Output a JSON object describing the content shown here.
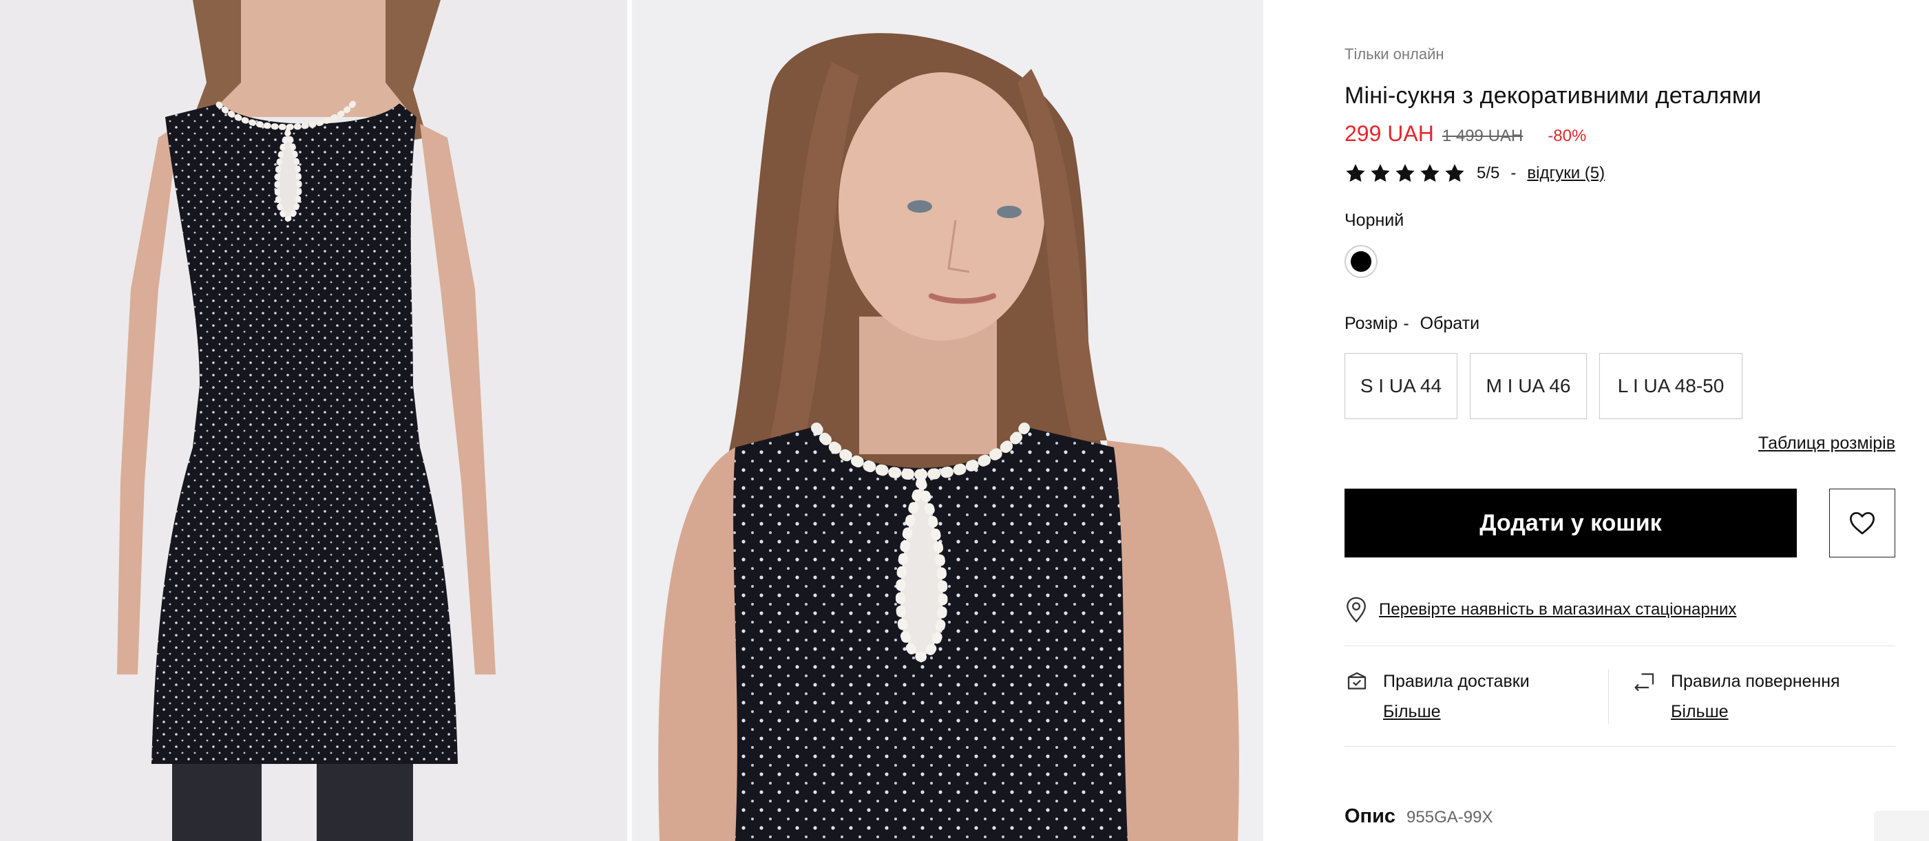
{
  "product": {
    "online_label": "Тільки онлайн",
    "title": "Міні-сукня з декоративними деталями",
    "price_current": "299 UAH",
    "price_old": "1 499 UAH",
    "discount": "-80%"
  },
  "rating": {
    "stars": 5,
    "value": "5/5",
    "separator": "-",
    "reviews_link": "відгуки (5)"
  },
  "color": {
    "label": "Чорний",
    "swatch_hex": "#000000"
  },
  "size": {
    "label": "Розмір",
    "separator": "-",
    "choose": "Обрати",
    "options": [
      "S I UA 44",
      "M I UA 46",
      "L I UA 48-50"
    ],
    "table_link": "Таблиця розмірів"
  },
  "actions": {
    "add_to_cart": "Додати у кошик",
    "wishlist_icon": "heart-icon"
  },
  "stores": {
    "icon": "location-pin-icon",
    "link": "Перевірте наявність в магазинах стаціонарних"
  },
  "policies": {
    "delivery": {
      "icon": "delivery-box-icon",
      "title": "Правила доставки",
      "more": "Більше"
    },
    "returns": {
      "icon": "return-arrow-icon",
      "title": "Правила повернення",
      "more": "Більше"
    }
  },
  "description": {
    "title": "Опис",
    "code": "955GA-99X"
  },
  "colors": {
    "price_red": "#e3262d",
    "button_black": "#000000",
    "text_gray": "#7a7a7a"
  }
}
